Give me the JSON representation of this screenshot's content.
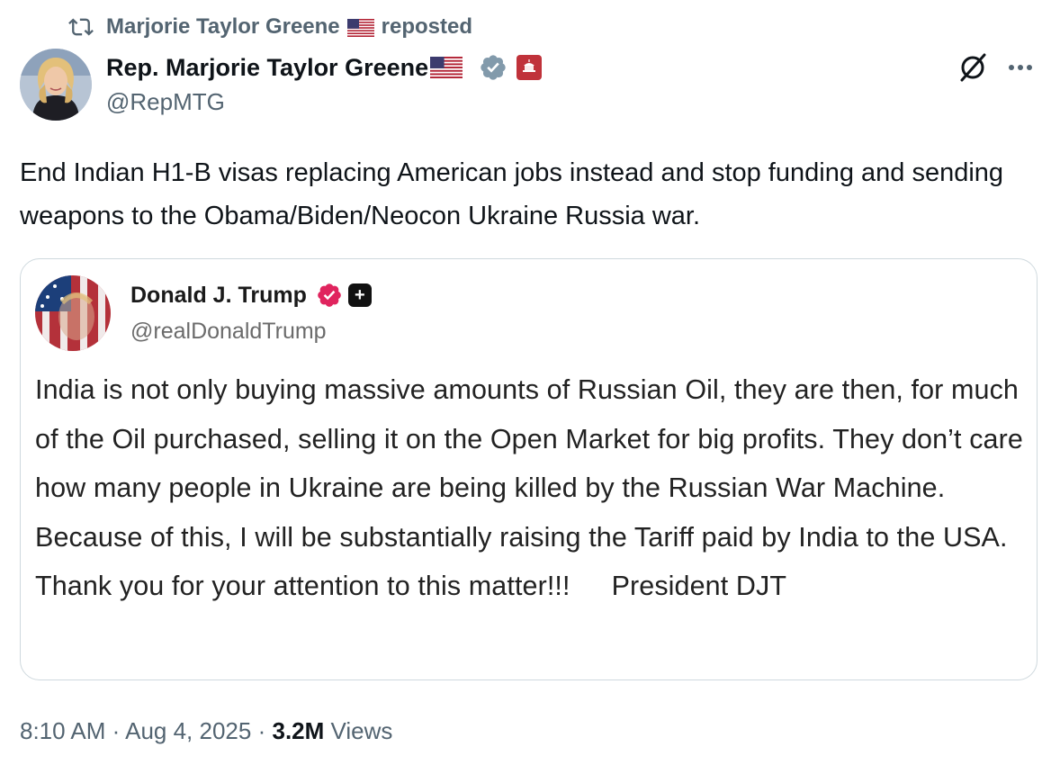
{
  "repost": {
    "user": "Marjorie Taylor Greene",
    "label": "reposted",
    "icon": "repost-icon"
  },
  "author": {
    "name": "Rep. Marjorie Taylor Greene",
    "handle": "@RepMTG",
    "badges": [
      "us-flag-icon",
      "verified-badge-icon",
      "government-badge-icon"
    ]
  },
  "actions": {
    "grok_icon": "grok-icon",
    "more_icon": "more-icon"
  },
  "tweet": {
    "text": "End Indian H1-B visas replacing American jobs instead and stop funding and sending weapons to the Obama/Biden/Neocon Ukraine Russia war."
  },
  "quoted": {
    "name": "Donald J. Trump",
    "handle": "@realDonaldTrump",
    "body": "India is not only buying massive amounts of Russian Oil, they are then, for much of the Oil purchased, selling it on the Open Market for big profits. They don’t care how many people in Ukraine are being killed by the Russian War Machine. Because of this, I will be substantially raising the Tariff paid by India to the USA. Thank you for your attention to this matter!!!",
    "signature": "President DJT"
  },
  "meta": {
    "time": "8:10 AM",
    "date": "Aug 4, 2025",
    "views_count": "3.2M",
    "views_label": "Views",
    "separator": "·"
  },
  "colors": {
    "secondary_text": "#536471",
    "border": "#cfd9de",
    "verified_blue_gray": "#829aab",
    "verified_pink": "#e0245e",
    "gov_red": "#c0323a"
  }
}
